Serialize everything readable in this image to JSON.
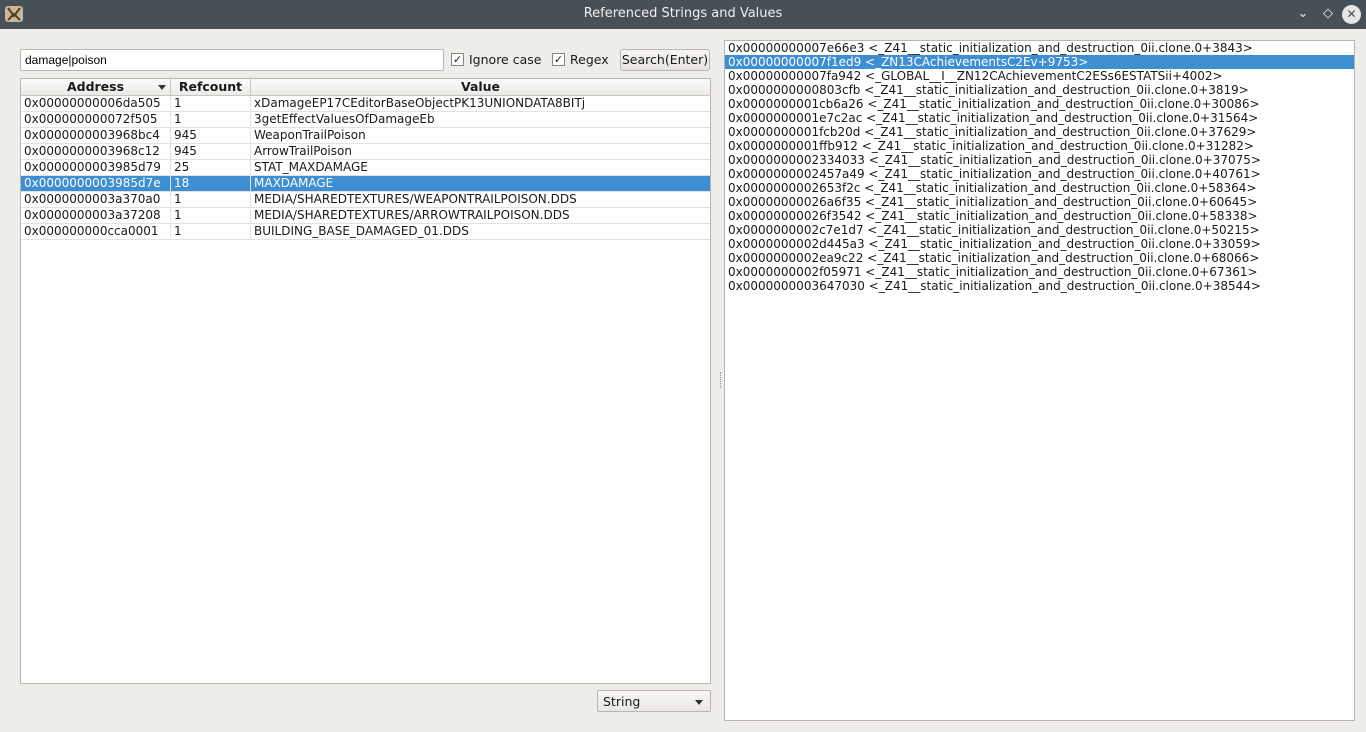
{
  "window": {
    "title": "Referenced Strings and Values",
    "controls": {
      "minimize": "⌄",
      "maximize": "◇",
      "close": "✕"
    }
  },
  "search": {
    "query": "damage|poison",
    "ignore_case": {
      "label": "Ignore case",
      "checked": true
    },
    "regex": {
      "label": "Regex",
      "checked": true
    },
    "button_label": "Search(Enter)"
  },
  "table": {
    "columns": [
      "Address",
      "Refcount",
      "Value"
    ],
    "sort_column": "Address",
    "selected_index": 5,
    "rows": [
      {
        "address": "0x00000000006da505",
        "refcount": "1",
        "value": "xDamageEP17CEditorBaseObjectPK13UNIONDATA8BITj"
      },
      {
        "address": "0x000000000072f505",
        "refcount": "1",
        "value": "3getEffectValuesOfDamageEb"
      },
      {
        "address": "0x0000000003968bc4",
        "refcount": "945",
        "value": "WeaponTrailPoison"
      },
      {
        "address": "0x0000000003968c12",
        "refcount": "945",
        "value": "ArrowTrailPoison"
      },
      {
        "address": "0x0000000003985d79",
        "refcount": "25",
        "value": "STAT_MAXDAMAGE"
      },
      {
        "address": "0x0000000003985d7e",
        "refcount": "18",
        "value": "MAXDAMAGE"
      },
      {
        "address": "0x0000000003a370a0",
        "refcount": "1",
        "value": "MEDIA/SHAREDTEXTURES/WEAPONTRAILPOISON.DDS"
      },
      {
        "address": "0x0000000003a37208",
        "refcount": "1",
        "value": "MEDIA/SHAREDTEXTURES/ARROWTRAILPOISON.DDS"
      },
      {
        "address": "0x000000000cca0001",
        "refcount": "1",
        "value": "BUILDING_BASE_DAMAGED_01.DDS"
      }
    ]
  },
  "type_select": {
    "value": "String"
  },
  "references": {
    "selected_index": 1,
    "items": [
      "0x00000000007e66e3 <_Z41__static_initialization_and_destruction_0ii.clone.0+3843>",
      "0x00000000007f1ed9 <_ZN13CAchievementsC2Ev+9753>",
      "0x00000000007fa942 <_GLOBAL__I__ZN12CAchievementC2ESs6ESTATSii+4002>",
      "0x0000000000803cfb <_Z41__static_initialization_and_destruction_0ii.clone.0+3819>",
      "0x0000000001cb6a26 <_Z41__static_initialization_and_destruction_0ii.clone.0+30086>",
      "0x0000000001e7c2ac <_Z41__static_initialization_and_destruction_0ii.clone.0+31564>",
      "0x0000000001fcb20d <_Z41__static_initialization_and_destruction_0ii.clone.0+37629>",
      "0x0000000001ffb912 <_Z41__static_initialization_and_destruction_0ii.clone.0+31282>",
      "0x0000000002334033 <_Z41__static_initialization_and_destruction_0ii.clone.0+37075>",
      "0x0000000002457a49 <_Z41__static_initialization_and_destruction_0ii.clone.0+40761>",
      "0x0000000002653f2c <_Z41__static_initialization_and_destruction_0ii.clone.0+58364>",
      "0x00000000026a6f35 <_Z41__static_initialization_and_destruction_0ii.clone.0+60645>",
      "0x00000000026f3542 <_Z41__static_initialization_and_destruction_0ii.clone.0+58338>",
      "0x0000000002c7e1d7 <_Z41__static_initialization_and_destruction_0ii.clone.0+50215>",
      "0x0000000002d445a3 <_Z41__static_initialization_and_destruction_0ii.clone.0+33059>",
      "0x0000000002ea9c22 <_Z41__static_initialization_and_destruction_0ii.clone.0+68066>",
      "0x0000000002f05971 <_Z41__static_initialization_and_destruction_0ii.clone.0+67361>",
      "0x0000000003647030 <_Z41__static_initialization_and_destruction_0ii.clone.0+38544>"
    ]
  },
  "colors": {
    "titlebar": "#475057",
    "selection": "#3d8ed3",
    "background": "#efedea"
  }
}
